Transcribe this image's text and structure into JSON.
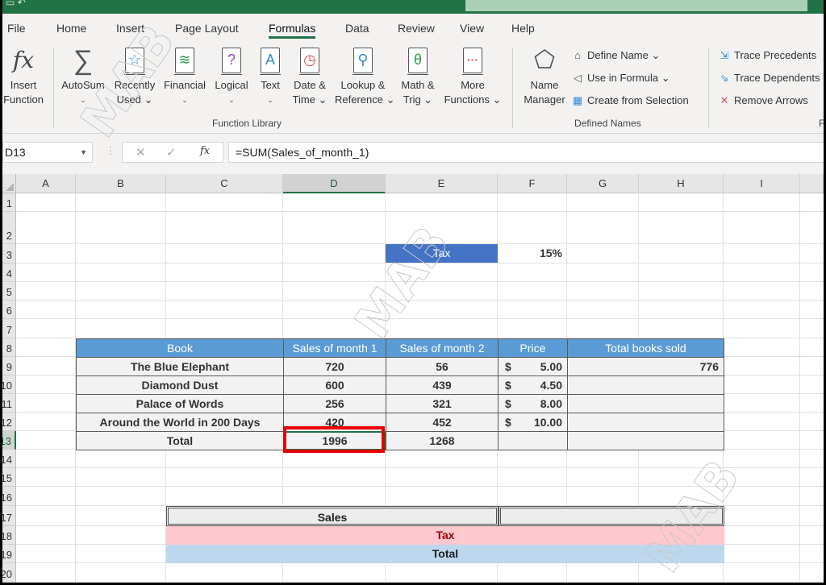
{
  "window": {
    "quick_access_icon": "save-icon"
  },
  "tabs": [
    {
      "label": "File",
      "active": false
    },
    {
      "label": "Home",
      "active": false
    },
    {
      "label": "Insert",
      "active": false
    },
    {
      "label": "Page Layout",
      "active": false
    },
    {
      "label": "Formulas",
      "active": true
    },
    {
      "label": "Data",
      "active": false
    },
    {
      "label": "Review",
      "active": false
    },
    {
      "label": "View",
      "active": false
    },
    {
      "label": "Help",
      "active": false
    }
  ],
  "ribbon": {
    "function_library": {
      "group_label": "Function Library",
      "insert_function": {
        "line1": "Insert",
        "line2": "Function",
        "icon": "fx"
      },
      "buttons": [
        {
          "line1": "AutoSum",
          "line2": "⌄",
          "icon": "∑"
        },
        {
          "line1": "Recently",
          "line2": "Used ⌄",
          "icon": "☆"
        },
        {
          "line1": "Financial",
          "line2": "⌄",
          "icon": "≋"
        },
        {
          "line1": "Logical",
          "line2": "⌄",
          "icon": "?"
        },
        {
          "line1": "Text",
          "line2": "⌄",
          "icon": "A"
        },
        {
          "line1": "Date &",
          "line2": "Time ⌄",
          "icon": "◷"
        },
        {
          "line1": "Lookup &",
          "line2": "Reference ⌄",
          "icon": "⚲"
        },
        {
          "line1": "Math &",
          "line2": "Trig ⌄",
          "icon": "θ"
        },
        {
          "line1": "More",
          "line2": "Functions ⌄",
          "icon": "···"
        }
      ]
    },
    "defined_names": {
      "group_label": "Defined Names",
      "name_manager": {
        "line1": "Name",
        "line2": "Manager"
      },
      "define_name": "Define Name ⌄",
      "use_in_formula": "Use in Formula ⌄",
      "create_from_selection": "Create from Selection"
    },
    "formula_auditing": {
      "group_label_partial": "F",
      "trace_precedents": "Trace Precedents",
      "trace_dependents": "Trace Dependents",
      "remove_arrows": "Remove Arrows"
    }
  },
  "formula_bar": {
    "name_box": "D13",
    "cancel": "✕",
    "enter": "✓",
    "fx": "fx",
    "formula": "=SUM(Sales_of_month_1)"
  },
  "grid": {
    "columns": [
      "A",
      "B",
      "C",
      "D",
      "E",
      "F",
      "G",
      "H",
      "I"
    ],
    "selected_column": "D",
    "rows": [
      "1",
      "2",
      "3",
      "4",
      "5",
      "6",
      "7",
      "8",
      "9",
      "10",
      "11",
      "12",
      "13",
      "14",
      "15",
      "16",
      "17",
      "18",
      "19",
      "20"
    ],
    "selected_row": "13",
    "tax": {
      "label": "Tax",
      "value": "15%"
    },
    "table": {
      "headers": [
        "Book",
        "Sales of month 1",
        "Sales of month 2",
        "Price",
        "Total books sold"
      ],
      "rows": [
        {
          "book": "The Blue Elephant",
          "m1": "720",
          "m2": "56",
          "currency": "$",
          "price": "5.00",
          "total": "776"
        },
        {
          "book": "Diamond Dust",
          "m1": "600",
          "m2": "439",
          "currency": "$",
          "price": "4.50",
          "total": ""
        },
        {
          "book": "Palace of Words",
          "m1": "256",
          "m2": "321",
          "currency": "$",
          "price": "8.00",
          "total": ""
        },
        {
          "book": "Around the World in 200 Days",
          "m1": "420",
          "m2": "452",
          "currency": "$",
          "price": "10.00",
          "total": ""
        }
      ],
      "total_row": {
        "label": "Total",
        "m1": "1996",
        "m2": "1268"
      }
    },
    "summary": {
      "sales": "Sales",
      "tax": "Tax",
      "total": "Total"
    },
    "highlight_color": "#e60000",
    "watermark": "MAB"
  }
}
